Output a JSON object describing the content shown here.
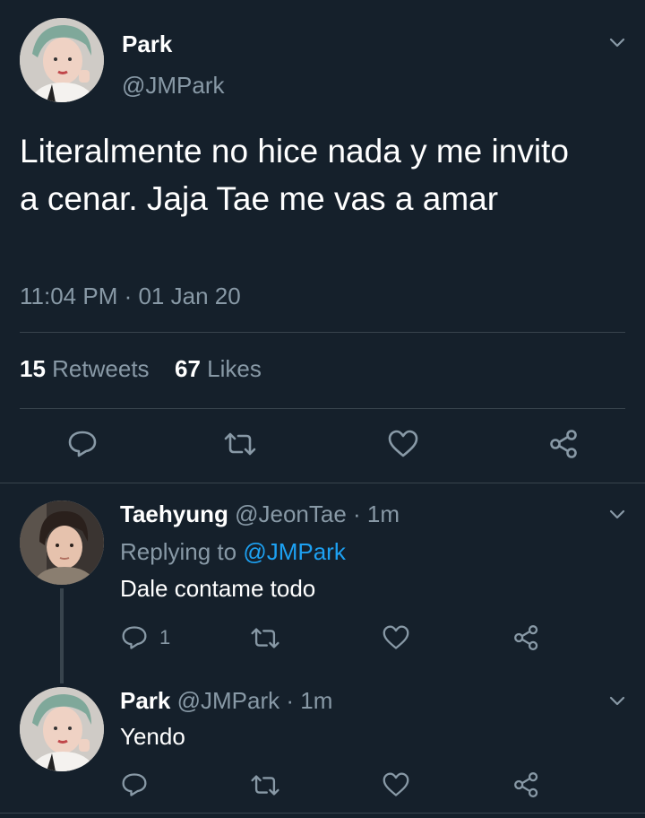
{
  "main_tweet": {
    "display_name": "Park",
    "handle": "@JMPark",
    "text": "Literalmente no hice nada y me invito a cenar. Jaja Tae me vas a amar",
    "timestamp": "11:04 PM · 01 Jan 20",
    "retweets_count": "15",
    "retweets_label": "Retweets",
    "likes_count": "67",
    "likes_label": "Likes"
  },
  "replies": [
    {
      "display_name": "Taehyung",
      "handle": "@JeonTae",
      "time": "· 1m",
      "replying_prefix": "Replying to",
      "replying_to": "@JMPark",
      "text": "Dale contame todo",
      "reply_count": "1"
    },
    {
      "display_name": "Park",
      "handle": "@JMPark",
      "time": "· 1m",
      "text": "Yendo"
    }
  ],
  "icons": {
    "reply": "reply-icon",
    "retweet": "retweet-icon",
    "like": "heart-icon",
    "share": "share-icon",
    "more": "chevron-down-icon"
  },
  "colors": {
    "background": "#15202b",
    "text": "#ffffff",
    "muted": "#8899a6",
    "link": "#1da1f2",
    "divider": "#38444d"
  }
}
